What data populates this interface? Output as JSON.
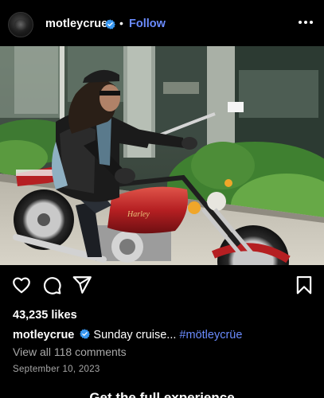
{
  "post": {
    "username": "motleycrue",
    "separator": "•",
    "follow_label": "Follow",
    "more_icon": "more-horizontal-icon",
    "likes": "43,235 likes",
    "caption_username": "motleycrue",
    "caption_text": "Sunday cruise...",
    "caption_hashtag": "#mötleycrüe",
    "view_comments": "View all 118 comments",
    "date": "September 10, 2023",
    "cta": "Get the full experience"
  },
  "icons": {
    "verified": "verified-badge-icon",
    "like": "heart-icon",
    "comment": "comment-bubble-icon",
    "share": "paper-plane-icon",
    "save": "bookmark-icon"
  },
  "colors": {
    "background": "#000000",
    "accent_link": "#6b8cff",
    "verified_blue": "#3897f0",
    "muted_text": "#a8a8a8",
    "tank_red": "#c0282b"
  }
}
